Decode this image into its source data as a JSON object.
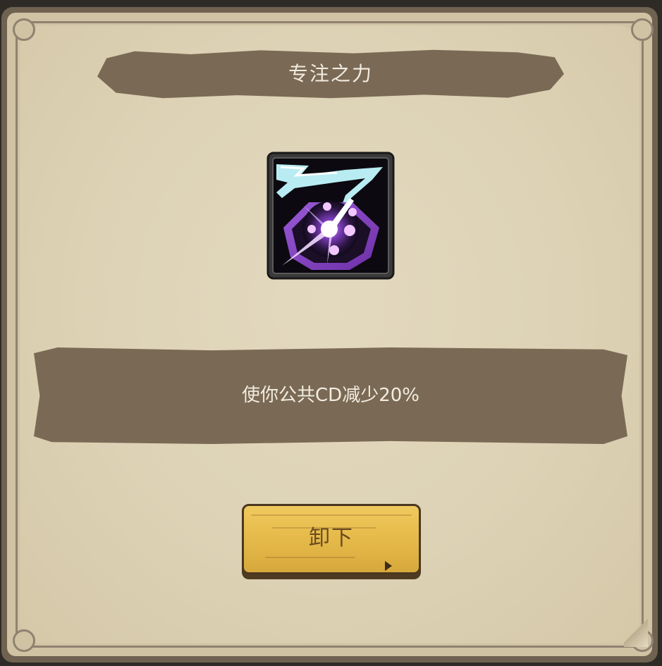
{
  "dialog": {
    "title": "专注之力",
    "skill_icon": "focus-power-icon",
    "description": "使你公共CD减少20%",
    "unequip_label": "卸下"
  },
  "colors": {
    "parchment": "#ddd2b5",
    "banner": "#7a6a55",
    "button": "#e6bb4b",
    "icon_purple": "#8a48c4",
    "icon_cyan": "#b8ecf2"
  }
}
